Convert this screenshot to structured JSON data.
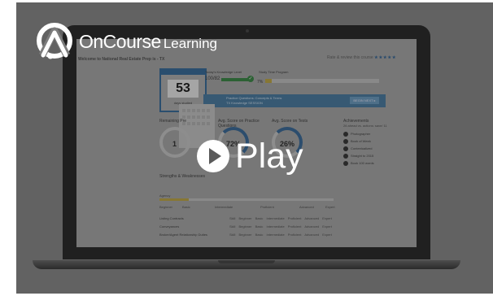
{
  "brand": {
    "name": "OnCourse",
    "suffix": "Learning"
  },
  "video": {
    "play_label": "Play"
  },
  "dashboard": {
    "welcome": "Welcome to National Real Estate Prep is - TX",
    "rating_label": "Rate & review this course",
    "rating_stars": "★★★★★",
    "streak_day": "53",
    "streak_label": "days studied",
    "knowledge_label": "Today's Knowledge Level",
    "knowledge_value": "100/82",
    "study_label": "Study Time Program",
    "study_value": "7%",
    "banner_line1": "Practice Questions: Concepts & Terms",
    "banner_line2": "TX Knowledge SESSION",
    "banner_button": "BEGIN NEXT ▸",
    "metrics": [
      {
        "label": "Remaining Pre",
        "value": "1"
      },
      {
        "label": "Avg. Score on Practice Questions",
        "value": "72%"
      },
      {
        "label": "Avg. Score on Tests",
        "value": "26%"
      }
    ],
    "achievements_title": "Achievements",
    "achievements_sub": "26 ahead vs. actions: save/ 11",
    "achievements": [
      "Photographer",
      "Book of Week",
      "Contextualized",
      "Straight to 2015",
      "Book 100 words"
    ],
    "strengths_title": "Strengths & Weaknesses",
    "strengths_sub": "Agency",
    "scale": [
      "Beginner",
      "Basic",
      "Intermediate",
      "Proficient",
      "Advanced",
      "Expert"
    ],
    "rows": [
      "Listing Contracts",
      "Conveyances",
      "Broker/Agent Relationship Duties"
    ],
    "row_levels": "Skill Beginner Basic Intermediate Proficient Advanced Expert"
  }
}
